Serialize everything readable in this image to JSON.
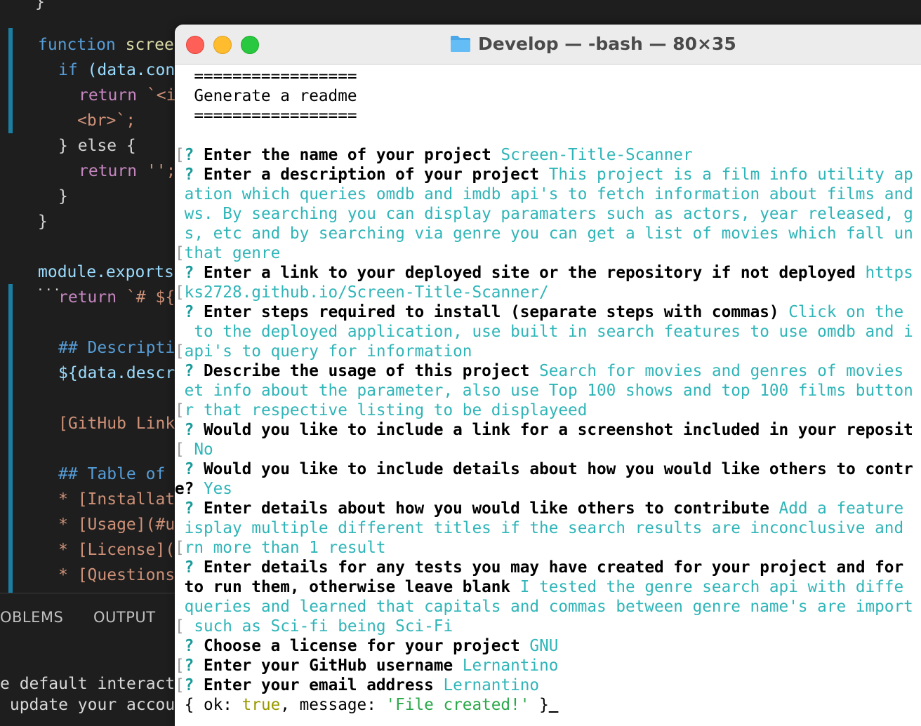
{
  "editor": {
    "lines": [
      {
        "kw": "function",
        "text": " scree"
      },
      {
        "kw": "if",
        "text": " (data.con"
      },
      {
        "kw": "return",
        "text": " `<i"
      },
      {
        "kw": "",
        "text": "<br>`;"
      },
      {
        "kw": "",
        "text": "} else {"
      },
      {
        "kw": "return",
        "text": " '';"
      },
      {
        "kw": "",
        "text": "}"
      },
      {
        "kw": "",
        "text": "}"
      },
      {
        "kw": "",
        "text": "module.exports"
      },
      {
        "kw": "return",
        "text": " `# ${"
      },
      {
        "kw": "",
        "text": "## Descripti"
      },
      {
        "kw": "",
        "text": "${data.descr"
      },
      {
        "kw": "",
        "text": "[GitHub Link"
      },
      {
        "kw": "",
        "text": "## Table of "
      },
      {
        "kw": "",
        "text": "* [Installat"
      },
      {
        "kw": "",
        "text": "* [Usage](#u"
      },
      {
        "kw": "",
        "text": "* [License]("
      },
      {
        "kw": "",
        "text": "* [Questions"
      }
    ],
    "colors": {
      "keyword": "#569cd6",
      "string": "#ce9178",
      "identifier": "#9cdcfe",
      "function": "#dcdcaa",
      "heading": "#569cd6",
      "text": "#d4d4d4"
    }
  },
  "panel": {
    "tabs": [
      "OBLEMS",
      "OUTPUT"
    ],
    "lines": [
      "e default interacti",
      " update your accour"
    ]
  },
  "terminal": {
    "title": "Develop — -bash — 80×35",
    "lines": [
      {
        "type": "plain",
        "text": "  ================="
      },
      {
        "type": "plain",
        "text": "  Generate a readme"
      },
      {
        "type": "plain",
        "text": "  ================="
      },
      {
        "type": "plain",
        "text": ""
      },
      {
        "type": "qa",
        "prefix": "[",
        "q": "Enter the name of your project",
        "a": "Screen-Title-Scanner"
      },
      {
        "type": "qa",
        "prefix": " ",
        "q": "Enter a description of your project",
        "a": "This project is a film info utility ap"
      },
      {
        "type": "cont",
        "prefix": " ",
        "text": "ation which queries omdb and imdb api's to fetch information about films and"
      },
      {
        "type": "cont",
        "prefix": " ",
        "text": "ws. By searching you can display paramaters such as actors, year released, g"
      },
      {
        "type": "cont",
        "prefix": " ",
        "text": "s, etc and by searching via genre you can get a list of movies which fall un"
      },
      {
        "type": "cont",
        "prefix": "[",
        "text": "that genre"
      },
      {
        "type": "qa",
        "prefix": " ",
        "q": "Enter a link to your deployed site or the repository if not deployed",
        "a": "https"
      },
      {
        "type": "cont",
        "prefix": "[",
        "text": "ks2728.github.io/Screen-Title-Scanner/"
      },
      {
        "type": "qa",
        "prefix": " ",
        "q": "Enter steps required to install (separate steps with commas)",
        "a": "Click on the"
      },
      {
        "type": "cont",
        "prefix": " ",
        "text": " to the deployed application, use built in search features to use omdb and i"
      },
      {
        "type": "cont",
        "prefix": "[",
        "text": "api's to query for information"
      },
      {
        "type": "qa",
        "prefix": " ",
        "q": "Describe the usage of this project",
        "a": "Search for movies and genres of movies"
      },
      {
        "type": "cont",
        "prefix": " ",
        "text": "et info about the parameter, also use Top 100 shows and top 100 films button"
      },
      {
        "type": "cont",
        "prefix": "[",
        "text": "r that respective listing to be displayeed"
      },
      {
        "type": "qa",
        "prefix": " ",
        "q": "Would you like to include a link for a screenshot included in your reposit",
        "a": ""
      },
      {
        "type": "cont",
        "prefix": "[",
        "text": " No"
      },
      {
        "type": "qa",
        "prefix": " ",
        "q": "Would you like to include details about how you would like others to contr",
        "a": ""
      },
      {
        "type": "qcont",
        "prefix": "",
        "q": "e?",
        "a": "Yes"
      },
      {
        "type": "qa",
        "prefix": " ",
        "q": "Enter details about how you would like others to contribute",
        "a": "Add a feature"
      },
      {
        "type": "cont",
        "prefix": " ",
        "text": "isplay multiple different titles if the search results are inconclusive and"
      },
      {
        "type": "cont",
        "prefix": "[",
        "text": "rn more than 1 result"
      },
      {
        "type": "qa",
        "prefix": " ",
        "q": "Enter details for any tests you may have created for your project and for",
        "a": ""
      },
      {
        "type": "qcont",
        "prefix": " ",
        "q": "to run them, otherwise leave blank",
        "a": "I tested the genre search api with diffe"
      },
      {
        "type": "cont",
        "prefix": " ",
        "text": "queries and learned that capitals and commas between genre name's are import"
      },
      {
        "type": "cont",
        "prefix": "[",
        "text": " such as Sci-fi being Sci-Fi"
      },
      {
        "type": "qa",
        "prefix": " ",
        "q": "Choose a license for your project",
        "a": "GNU"
      },
      {
        "type": "qa",
        "prefix": "[",
        "q": "Enter your GitHub username",
        "a": "Lernantino"
      },
      {
        "type": "qa",
        "prefix": "[",
        "q": "Enter your email address",
        "a": "Lernantino"
      }
    ],
    "result": {
      "open": "{ ok: ",
      "ok_value": "true",
      "mid": ", message: ",
      "message": "'File created!'",
      "close": " }"
    }
  }
}
